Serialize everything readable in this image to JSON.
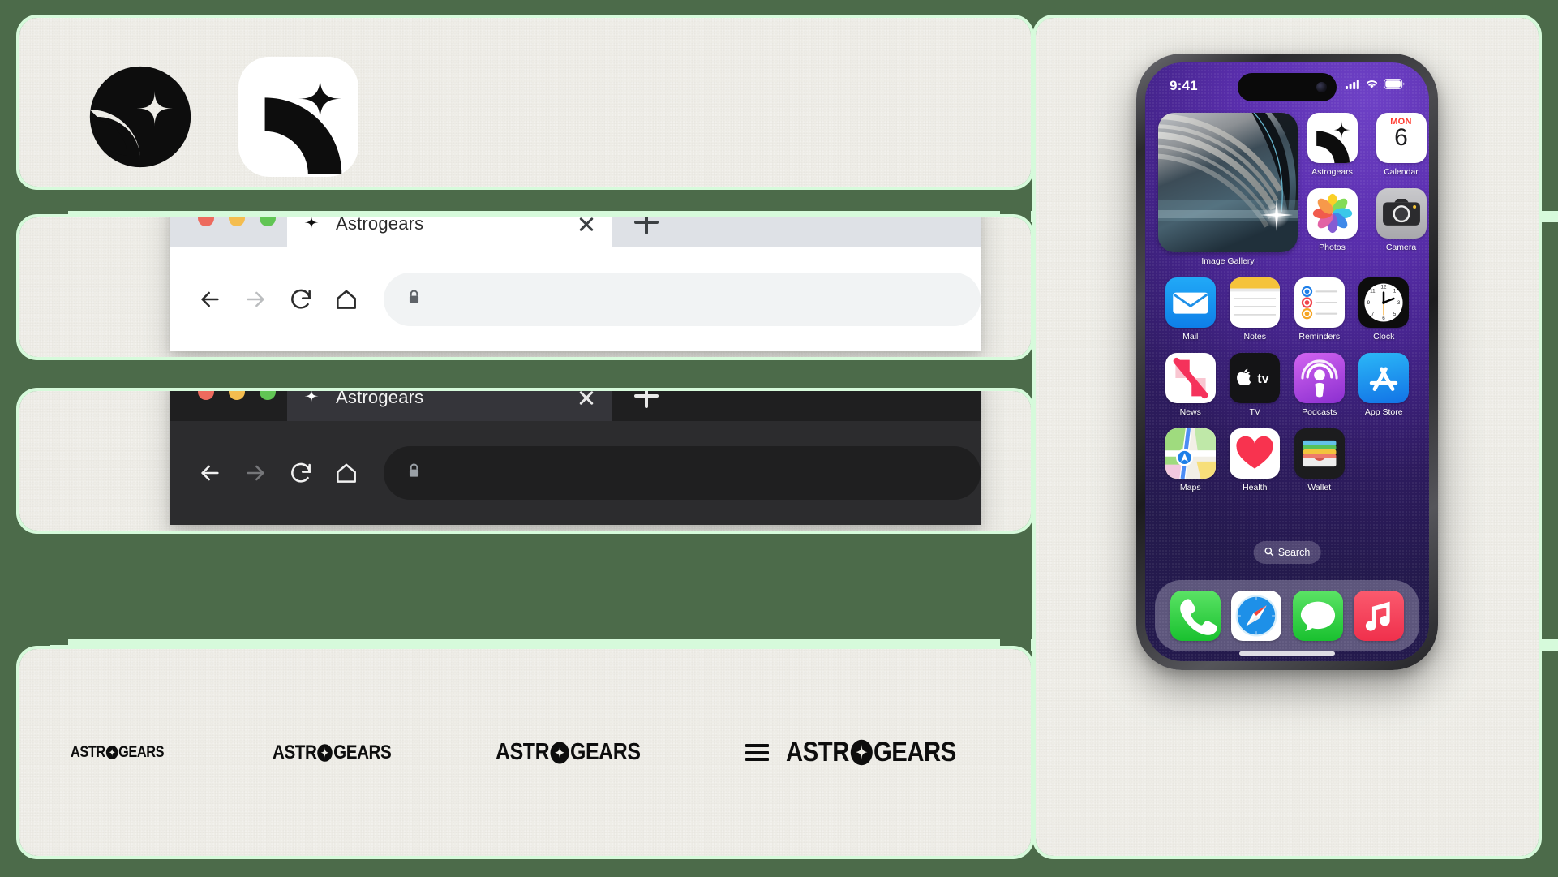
{
  "colors": {
    "stage_green": "#4C6B4A",
    "mint": "#D6FADB",
    "panel_cream": "#EFEEE8",
    "ink": "#0D0D0D",
    "wallpaper_purple": "#5B2FAF"
  },
  "brand": {
    "name": "Astrogears",
    "wordmark": "ASTROGEARS"
  },
  "logos": {
    "circle_mark_name": "astrogears-circle-logo",
    "squircle_mark_name": "astrogears-app-icon-logo"
  },
  "browser_light": {
    "theme": "light",
    "tab": {
      "title": "Astrogears",
      "favicon": "sparkle-icon",
      "close": "close-icon"
    },
    "new_tab": "+",
    "toolbar": {
      "back": "back-arrow-icon",
      "forward": "forward-arrow-icon",
      "reload": "reload-icon",
      "home": "home-icon",
      "lock": "lock-icon",
      "address_value": "",
      "address_placeholder": ""
    },
    "traffic_lights": {
      "close": "#ED6A5E",
      "minimize": "#F4BD4F",
      "zoom": "#61C554"
    }
  },
  "browser_dark": {
    "theme": "dark",
    "tab": {
      "title": "Astrogears",
      "favicon": "sparkle-icon",
      "close": "close-icon"
    },
    "new_tab": "+",
    "toolbar": {
      "back": "back-arrow-icon",
      "forward": "forward-arrow-icon",
      "reload": "reload-icon",
      "home": "home-icon",
      "lock": "lock-icon",
      "address_value": "",
      "address_placeholder": ""
    },
    "traffic_lights": {
      "close": "#ED6A5E",
      "minimize": "#F4BD4F",
      "zoom": "#61C554"
    }
  },
  "wordmarks": [
    {
      "text": "ASTROGEARS",
      "size": 19,
      "menu": false
    },
    {
      "text": "ASTROGEARS",
      "size": 24,
      "menu": false
    },
    {
      "text": "ASTROGEARS",
      "size": 29,
      "menu": false
    },
    {
      "text": "ASTROGEARS",
      "size": 34,
      "menu": true,
      "menu_icon": "hamburger-menu-icon"
    }
  ],
  "phone": {
    "status": {
      "time": "9:41",
      "cellular": "signal-bars-icon",
      "wifi": "wifi-icon",
      "battery": "battery-icon"
    },
    "widget": {
      "label": "Image Gallery",
      "name": "image-gallery-widget"
    },
    "calendar": {
      "weekday": "MON",
      "day": "6"
    },
    "apps_row1": [
      {
        "label": "Astrogears",
        "icon": "astrogears-icon"
      },
      {
        "label": "Calendar",
        "icon": "calendar-icon"
      }
    ],
    "apps_row2": [
      {
        "label": "Photos",
        "icon": "photos-icon"
      },
      {
        "label": "Camera",
        "icon": "camera-icon"
      }
    ],
    "apps_row3": [
      {
        "label": "Mail",
        "icon": "mail-icon"
      },
      {
        "label": "Notes",
        "icon": "notes-icon"
      },
      {
        "label": "Reminders",
        "icon": "reminders-icon"
      },
      {
        "label": "Clock",
        "icon": "clock-icon"
      }
    ],
    "apps_row4": [
      {
        "label": "News",
        "icon": "news-icon"
      },
      {
        "label": "TV",
        "icon": "tv-icon"
      },
      {
        "label": "Podcasts",
        "icon": "podcasts-icon"
      },
      {
        "label": "App Store",
        "icon": "app-store-icon"
      }
    ],
    "apps_row5": [
      {
        "label": "Maps",
        "icon": "maps-icon"
      },
      {
        "label": "Health",
        "icon": "health-icon"
      },
      {
        "label": "Wallet",
        "icon": "wallet-icon"
      }
    ],
    "search": {
      "label": "Search",
      "icon": "search-icon"
    },
    "dock": [
      {
        "label": "Phone",
        "icon": "phone-icon"
      },
      {
        "label": "Safari",
        "icon": "safari-icon"
      },
      {
        "label": "Messages",
        "icon": "messages-icon"
      },
      {
        "label": "Music",
        "icon": "music-icon"
      }
    ]
  }
}
